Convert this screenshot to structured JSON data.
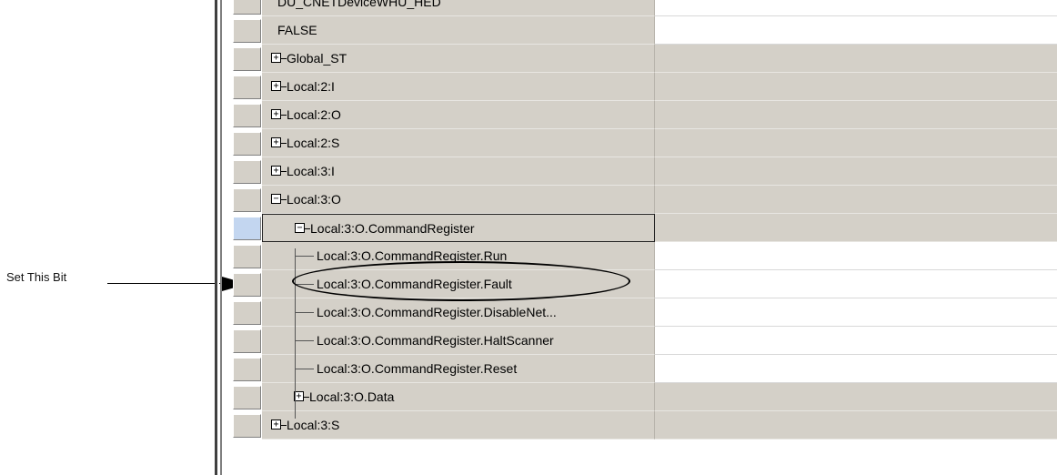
{
  "callout": {
    "label": "Set This Bit"
  },
  "rows": [
    {
      "label": "DU_CNETDeviceWHU_HED",
      "toggle": "",
      "indent": 0,
      "value_white": true
    },
    {
      "label": "FALSE",
      "toggle": "",
      "indent": 0,
      "value_white": true
    },
    {
      "label": "Global_ST",
      "toggle": "+",
      "indent": 0,
      "value_white": false
    },
    {
      "label": "Local:2:I",
      "toggle": "+",
      "indent": 0,
      "value_white": false
    },
    {
      "label": "Local:2:O",
      "toggle": "+",
      "indent": 0,
      "value_white": false
    },
    {
      "label": "Local:2:S",
      "toggle": "+",
      "indent": 0,
      "value_white": false
    },
    {
      "label": "Local:3:I",
      "toggle": "+",
      "indent": 0,
      "value_white": false
    },
    {
      "label": "Local:3:O",
      "toggle": "−",
      "indent": 0,
      "value_white": false
    },
    {
      "label": "Local:3:O.CommandRegister",
      "toggle": "−",
      "indent": 1,
      "value_white": false,
      "selected": true
    },
    {
      "label": "Local:3:O.CommandRegister.Run",
      "toggle": "",
      "indent": 2,
      "value_white": true,
      "circled": true
    },
    {
      "label": "Local:3:O.CommandRegister.Fault",
      "toggle": "",
      "indent": 2,
      "value_white": true
    },
    {
      "label": "Local:3:O.CommandRegister.DisableNet...",
      "toggle": "",
      "indent": 2,
      "value_white": true
    },
    {
      "label": "Local:3:O.CommandRegister.HaltScanner",
      "toggle": "",
      "indent": 2,
      "value_white": true
    },
    {
      "label": "Local:3:O.CommandRegister.Reset",
      "toggle": "",
      "indent": 2,
      "value_white": true
    },
    {
      "label": "Local:3:O.Data",
      "toggle": "+",
      "indent": 1,
      "value_white": false
    },
    {
      "label": "Local:3:S",
      "toggle": "+",
      "indent": 0,
      "value_white": false
    }
  ]
}
